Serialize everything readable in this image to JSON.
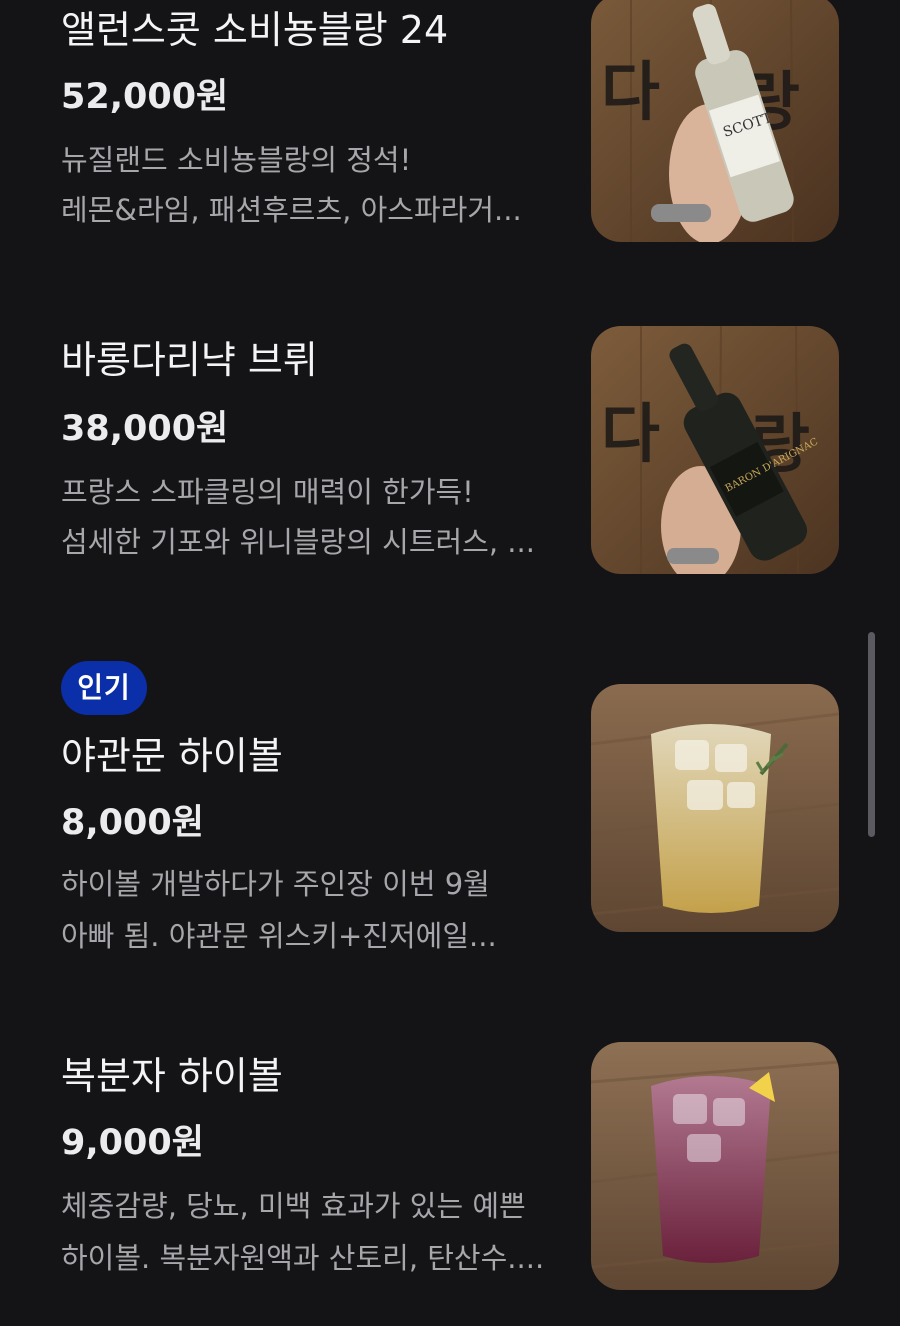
{
  "menu": {
    "items": [
      {
        "name": "앨런스콧 소비뇽블랑 24",
        "price": "52,000원",
        "desc_line1": "뉴질랜드 소비뇽블랑의 정석!",
        "desc_line2": "레몬&라임, 패션후르츠, 아스파라거...",
        "badge": "",
        "image_icon": "white-wine-bottle-photo"
      },
      {
        "name": "바롱다리냑 브뤼",
        "price": "38,000원",
        "desc_line1": "프랑스 스파클링의 매력이 한가득!",
        "desc_line2": "섬세한 기포와 위니블랑의 시트러스, ...",
        "badge": "",
        "image_icon": "sparkling-wine-bottle-photo"
      },
      {
        "name": "야관문 하이볼",
        "price": "8,000원",
        "desc_line1": "하이볼 개발하다가 주인장 이번 9월",
        "desc_line2": "아빠 됨. 야관문 위스키+진저에일...",
        "badge": "인기",
        "image_icon": "highball-glass-photo"
      },
      {
        "name": "복분자 하이볼",
        "price": "9,000원",
        "desc_line1": "체중감량, 당뇨, 미백 효과가 있는 예쁜",
        "desc_line2": "하이볼. 복분자원액과 산토리, 탄산수....",
        "badge": "",
        "image_icon": "red-highball-glass-photo"
      }
    ]
  },
  "colors": {
    "background": "#141416",
    "badge": "#0a2fa8",
    "description": "#a6a6ab"
  }
}
